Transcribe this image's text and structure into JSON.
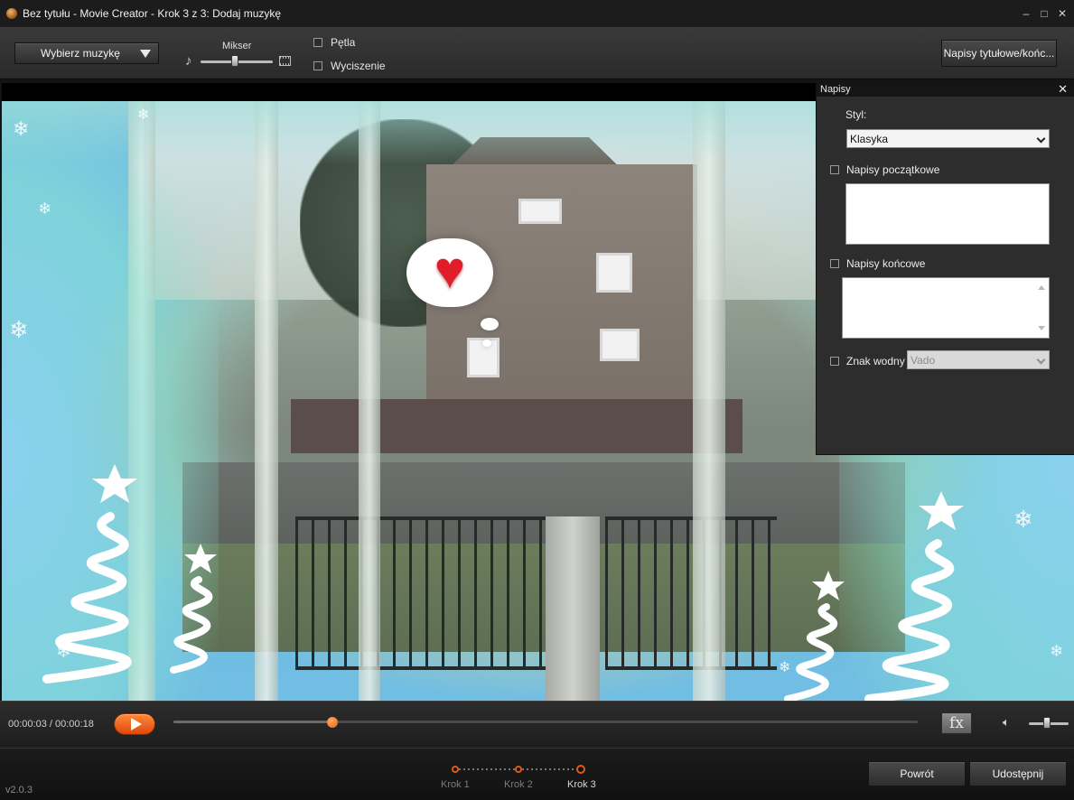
{
  "window": {
    "title": "Bez tytułu - Movie Creator - Krok 3 z 3: Dodaj muzykę",
    "controls": {
      "minimize": "–",
      "maximize": "□",
      "close": "✕"
    }
  },
  "toolbar": {
    "music_button": "Wybierz muzykę",
    "mixer_label": "Mikser",
    "loop_label": "Pętla",
    "mute_label": "Wyciszenie",
    "titles_button": "Napisy tytułowe/końc..."
  },
  "captions_panel": {
    "title": "Napisy",
    "close": "✕",
    "style_label": "Styl:",
    "style_value": "Klasyka",
    "opening_label": "Napisy początkowe",
    "closing_label": "Napisy końcowe",
    "watermark_label": "Znak wodny",
    "watermark_value": "Vado"
  },
  "player": {
    "time": "00:00:03 / 00:00:18",
    "progress": 0.214,
    "fx_label": "fx",
    "volume_level": 0.45
  },
  "steps": [
    {
      "label": "Krok 1",
      "active": false
    },
    {
      "label": "Krok 2",
      "active": false
    },
    {
      "label": "Krok 3",
      "active": true
    }
  ],
  "footer": {
    "version": "v2.0.3",
    "back_button": "Powrót",
    "share_button": "Udostępnij"
  },
  "icons": [
    "app-icon",
    "music-note-icon",
    "film-icon",
    "dropdown-arrow-icon",
    "play-icon",
    "fx-icon",
    "speaker-icon",
    "close-icon"
  ],
  "colors": {
    "accent": "#f05a10",
    "panel_bg": "#2d2d2d",
    "toolbar_bg": "#333333"
  }
}
